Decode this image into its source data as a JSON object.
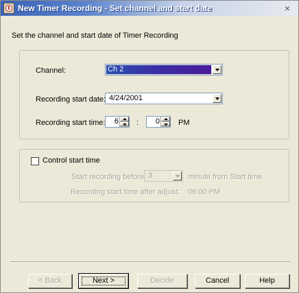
{
  "window": {
    "title": "New Timer Recording - Set channel and start date",
    "close_glyph": "×"
  },
  "instruction": "Set the channel and start date of Timer Recording",
  "channel": {
    "label": "Channel:",
    "value": "Ch 2"
  },
  "start_date": {
    "label": "Recording start date:",
    "value": "4/24/2001"
  },
  "start_time": {
    "label": "Recording start time:",
    "hour": "6",
    "separator": ":",
    "minute": "0",
    "ampm": "PM"
  },
  "control": {
    "checkbox_label": "Control start time",
    "checked": false,
    "before_label": "Start recording before",
    "before_value": "3",
    "before_unit": "minute from Start time",
    "after_adjust_label": "Recording start time after adjust:",
    "after_adjust_value": "06:00 PM"
  },
  "buttons": {
    "back": "< Back",
    "next": "Next >",
    "decide": "Decide",
    "cancel": "Cancel",
    "help": "Help"
  },
  "colors": {
    "title_gradient_start": "#3a63b8",
    "selection": "#3b2fa6",
    "face": "#ece9d8",
    "disabled_text": "#a8a596"
  }
}
